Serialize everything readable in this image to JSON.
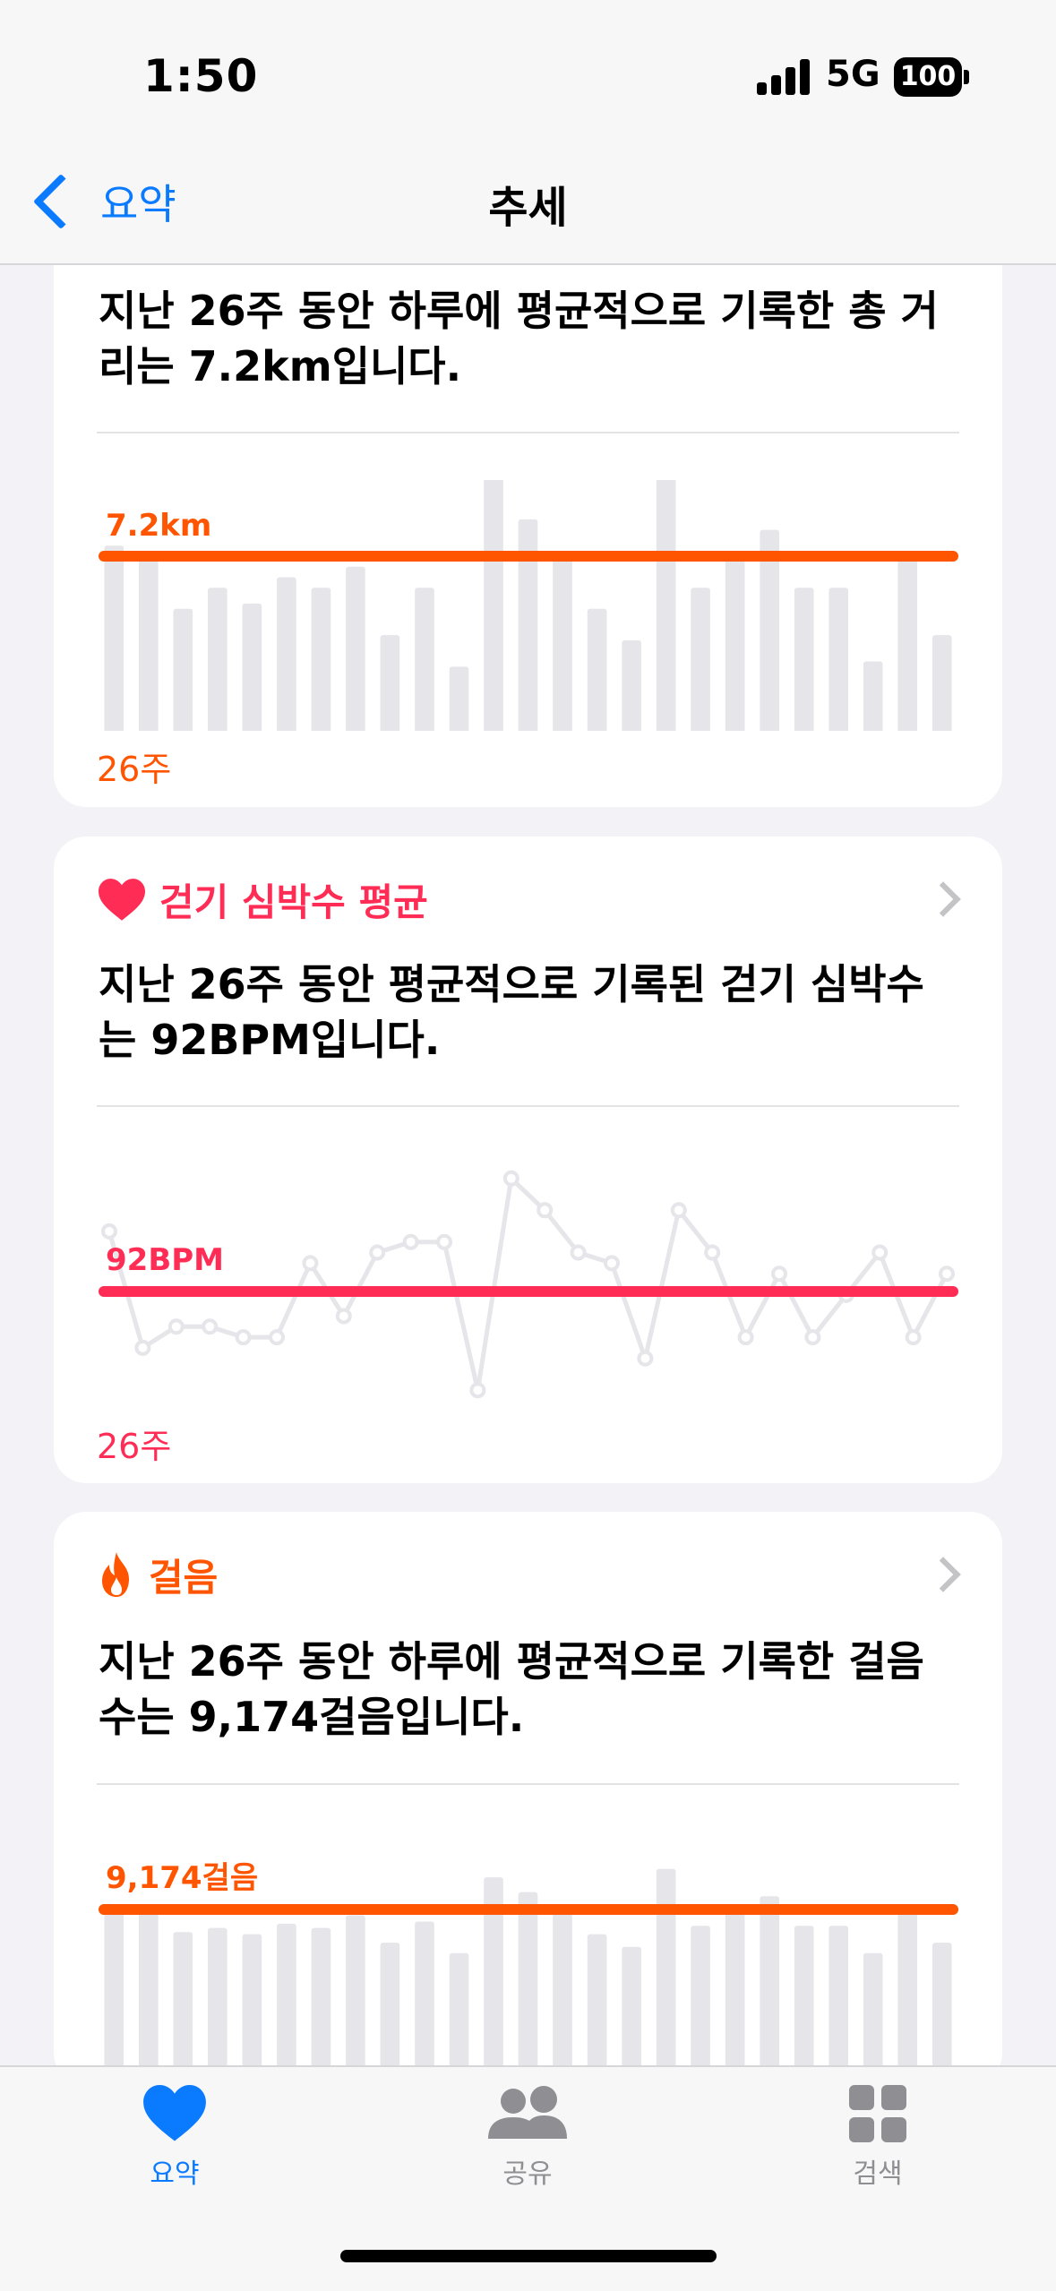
{
  "status": {
    "time": "1:50",
    "network": "5G",
    "battery": "100"
  },
  "nav": {
    "back_label": "요약",
    "title": "추세"
  },
  "colors": {
    "accent": "#0a7aff",
    "orange": "#ff5400",
    "pink": "#ff2d55"
  },
  "cards": [
    {
      "description": "지난 26주 동안 하루에 평균적으로 기록한 총 거리는 7.2km입니다.",
      "average_label": "7.2km",
      "period": "26주",
      "chart_data": {
        "type": "bar",
        "unit": "km",
        "average": 7.2,
        "values": [
          7.4,
          7.3,
          6.2,
          6.6,
          6.3,
          6.8,
          6.6,
          7.0,
          5.7,
          6.6,
          5.1,
          8.7,
          7.9,
          7.2,
          6.2,
          5.6,
          9.1,
          6.6,
          7.2,
          7.7,
          6.6,
          6.6,
          5.2,
          7.2,
          5.7
        ]
      }
    },
    {
      "title": "걷기 심박수 평균",
      "icon": "heart-icon",
      "description": "지난 26주 동안 평균적으로 기록된 걷기 심박수는 92BPM입니다.",
      "average_label": "92BPM",
      "period": "26주",
      "chart_data": {
        "type": "line",
        "unit": "BPM",
        "average": 92,
        "values": [
          96,
          85,
          87,
          87,
          86,
          86,
          93,
          88,
          94,
          95,
          95,
          81,
          101,
          98,
          94,
          93,
          84,
          98,
          94,
          86,
          92,
          86,
          90,
          94,
          86,
          92
        ]
      }
    },
    {
      "title": "걸음",
      "icon": "flame-icon",
      "description": "지난 26주 동안 하루에 평균적으로 기록한 걸음 수는 9,174걸음입니다.",
      "average_label": "9,174걸음",
      "period": "26주",
      "chart_data": {
        "type": "bar",
        "unit": "걸음",
        "average": 9174,
        "values": [
          9300,
          9200,
          8100,
          8300,
          8000,
          8500,
          8300,
          8900,
          7600,
          8600,
          7100,
          10700,
          10000,
          9200,
          8000,
          7400,
          11100,
          8400,
          9200,
          9800,
          8400,
          8400,
          7100,
          9200,
          7600
        ]
      }
    }
  ],
  "tabs": [
    {
      "label": "요약",
      "icon": "heart-icon",
      "active": true
    },
    {
      "label": "공유",
      "icon": "people-icon",
      "active": false
    },
    {
      "label": "검색",
      "icon": "grid-icon",
      "active": false
    }
  ]
}
